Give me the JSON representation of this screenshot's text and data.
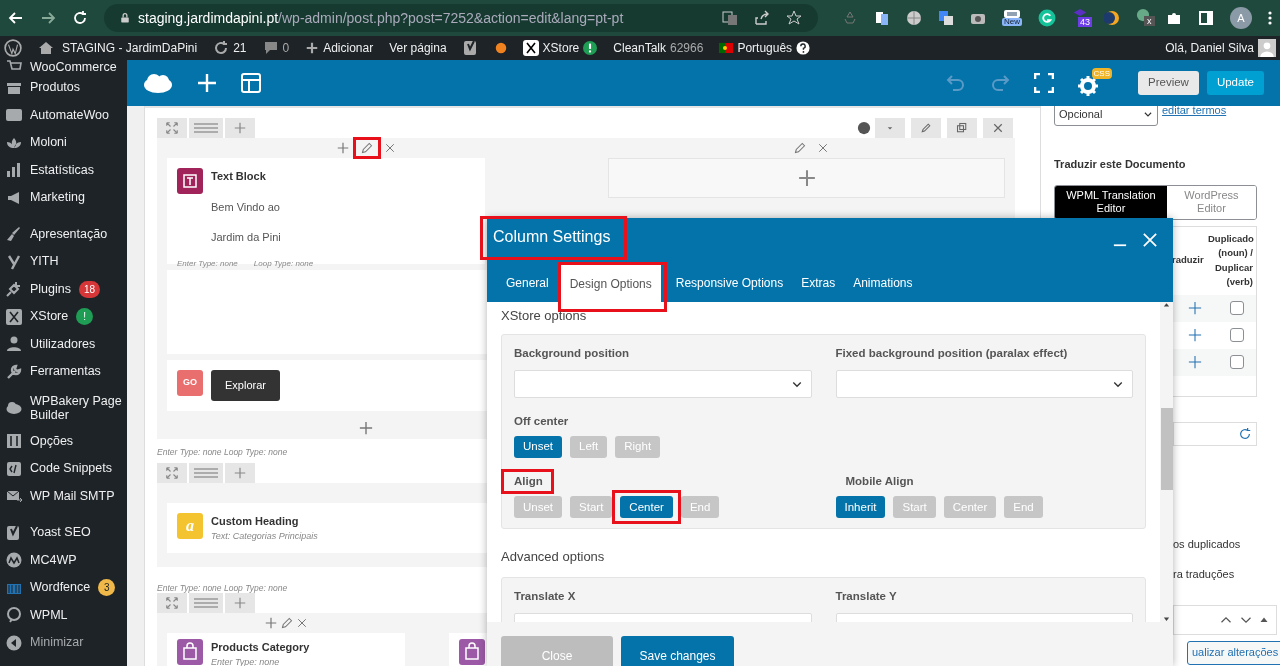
{
  "browser": {
    "url_host": "staging.jardimdapini.pt",
    "url_path": "/wp-admin/post.php?post=7252&action=edit&lang=pt-pt",
    "extension_badges": [
      "New",
      "43",
      "x"
    ],
    "profile_initial": "A"
  },
  "admin_bar": {
    "items": [
      {
        "kind": "wp"
      },
      {
        "kind": "site",
        "label": "STAGING - JardimDaPini"
      },
      {
        "kind": "updates",
        "label": "21"
      },
      {
        "kind": "comments",
        "label": "0"
      },
      {
        "kind": "new",
        "label": "Adicionar"
      },
      {
        "kind": "text",
        "label": "Ver página"
      },
      {
        "kind": "yoast"
      },
      {
        "kind": "dot"
      },
      {
        "kind": "xstore",
        "label": "XStore"
      },
      {
        "kind": "counter",
        "label": "CleanTalk",
        "count": "62966"
      },
      {
        "kind": "language",
        "label": "Português"
      }
    ],
    "greeting": "Olá, Daniel Silva"
  },
  "sidebar": {
    "groups": [
      {
        "items": [
          {
            "kind": "cart",
            "label": "WooCommerce"
          },
          {
            "kind": "box",
            "label": "Produtos"
          },
          {
            "kind": "aw",
            "label": "AutomateWoo"
          },
          {
            "kind": "lotus",
            "label": "Moloni"
          },
          {
            "kind": "chart",
            "label": "Estatísticas"
          },
          {
            "kind": "megaphone",
            "label": "Marketing"
          }
        ]
      },
      {
        "items": [
          {
            "kind": "brush",
            "label": "Apresentação"
          },
          {
            "kind": "y",
            "label": "YITH"
          },
          {
            "kind": "plug",
            "label": "Plugins",
            "badge": "18",
            "color": "#d63638"
          },
          {
            "kind": "x",
            "label": "XStore",
            "badge": "!",
            "color": "#1f9d55"
          },
          {
            "kind": "person",
            "label": "Utilizadores"
          },
          {
            "kind": "wrench",
            "label": "Ferramentas"
          },
          {
            "kind": "cloud",
            "label": "WPBakery Page Builder"
          },
          {
            "kind": "sliders",
            "label": "Opções"
          },
          {
            "kind": "code",
            "label": "Code Snippets"
          },
          {
            "kind": "mail",
            "label": "WP Mail SMTP"
          }
        ]
      },
      {
        "items": [
          {
            "kind": "yoast",
            "label": "Yoast SEO"
          },
          {
            "kind": "mc",
            "label": "MC4WP"
          },
          {
            "kind": "wall",
            "label": "Wordfence",
            "badge": "3",
            "color": "#f0b849"
          },
          {
            "kind": "wpml",
            "label": "WPML"
          },
          {
            "kind": "collapse",
            "label": "Minimizar"
          }
        ]
      }
    ]
  },
  "builder_bar": {
    "css_badge": "CSS",
    "buttons": [
      {
        "kind": "secondary",
        "label": "Preview"
      },
      {
        "kind": "primary",
        "label": "Update"
      }
    ]
  },
  "editor": {
    "rows": [
      {
        "columns": [
          {
            "elements": [
              {
                "kind": "text",
                "title": "Text Block",
                "lines": [
                  "Bem Vindo ao",
                  "Jardim da Pini"
                ],
                "meta": [
                  "Enter Type: none",
                  "Loop Type: none"
                ]
              },
              {
                "kind": "empty"
              },
              {
                "kind": "go",
                "icon_text": "GO",
                "button": "Explorar"
              }
            ],
            "highlighted_edit": true
          },
          {
            "elements": [
              {
                "kind": "placeholder"
              }
            ],
            "highlighted_edit": false
          }
        ],
        "meta": "Enter Type: none  Loop Type: none"
      },
      {
        "columns": [
          {
            "elements": [
              {
                "kind": "heading",
                "icon_text": "a",
                "title": "Custom Heading",
                "subtitle": "Text: Categorias Principais"
              }
            ]
          }
        ],
        "meta": "Enter Type: none  Loop Type: none"
      },
      {
        "columns": [
          {
            "elements": [
              {
                "kind": "products",
                "title": "Products Category",
                "subtitle": "Enter Type: none"
              }
            ]
          },
          {
            "elements": [
              {
                "kind": "products"
              }
            ]
          }
        ]
      }
    ]
  },
  "right_panel": {
    "select": "Opcional",
    "link": "editar termos",
    "heading": "Traduzir este Documento",
    "editor_toggle": [
      {
        "label": "WPML Translation Editor",
        "selected": true
      },
      {
        "label": "WordPress Editor",
        "selected": false
      }
    ],
    "table_headers": [
      "raduzir",
      "Duplicado (noun) / Duplicar (verb)"
    ],
    "rows": [
      {
        "checked": false
      },
      {
        "checked": false
      },
      {
        "checked": false
      }
    ],
    "notes": [
      "os duplicados",
      "ra traduções"
    ],
    "button": "ualizar alterações"
  },
  "modal": {
    "title": "Column Settings",
    "title_highlighted": true,
    "tabs": [
      {
        "label": "General",
        "selected": false,
        "highlighted": false
      },
      {
        "label": "Design Options",
        "selected": true,
        "highlighted": true
      },
      {
        "label": "Responsive Options",
        "selected": false,
        "highlighted": false
      },
      {
        "label": "Extras",
        "selected": false,
        "highlighted": false
      },
      {
        "label": "Animations",
        "selected": false,
        "highlighted": false
      }
    ],
    "section": "XStore options",
    "selects": [
      {
        "label": "Background position"
      },
      {
        "label": "Fixed background position (paralax effect)"
      }
    ],
    "groups": [
      {
        "label": "Off center",
        "highlighted": false,
        "options": [
          {
            "label": "Unset",
            "selected": true,
            "highlighted": false
          },
          {
            "label": "Left",
            "selected": false,
            "highlighted": false
          },
          {
            "label": "Right",
            "selected": false,
            "highlighted": false
          }
        ]
      },
      {
        "label": "Align",
        "highlighted": true,
        "options": [
          {
            "label": "Unset",
            "selected": false,
            "highlighted": false
          },
          {
            "label": "Start",
            "selected": false,
            "highlighted": false
          },
          {
            "label": "Center",
            "selected": true,
            "highlighted": true
          },
          {
            "label": "End",
            "selected": false,
            "highlighted": false
          }
        ]
      },
      {
        "label": "Mobile Align",
        "highlighted": false,
        "options": [
          {
            "label": "Inherit",
            "selected": true,
            "highlighted": false
          },
          {
            "label": "Start",
            "selected": false,
            "highlighted": false
          },
          {
            "label": "Center",
            "selected": false,
            "highlighted": false
          },
          {
            "label": "End",
            "selected": false,
            "highlighted": false
          }
        ]
      }
    ],
    "advanced": "Advanced options",
    "inputs": [
      {
        "label": "Translate X"
      },
      {
        "label": "Translate Y"
      }
    ],
    "footer": [
      {
        "kind": "secondary",
        "label": "Close"
      },
      {
        "kind": "primary",
        "label": "Save changes"
      }
    ]
  }
}
